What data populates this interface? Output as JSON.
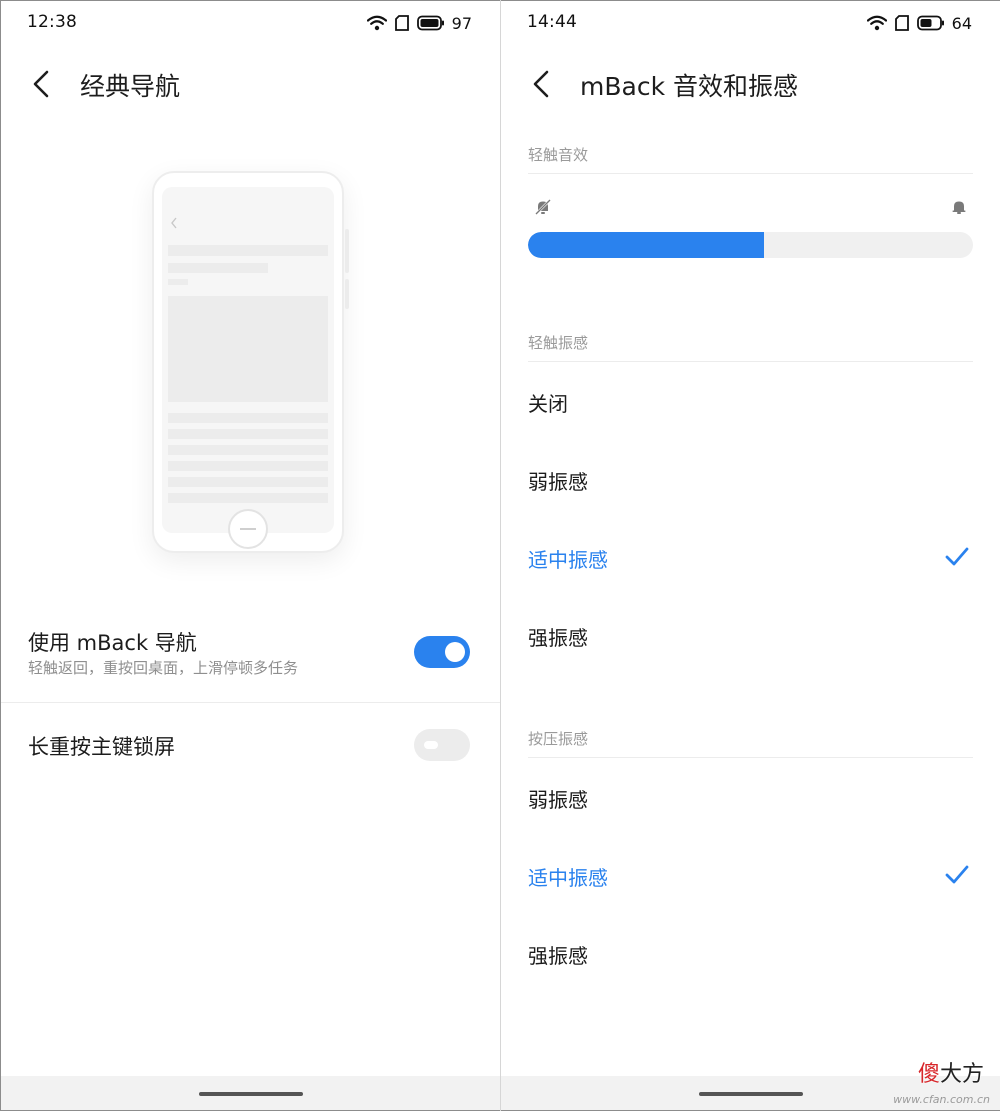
{
  "left_screen": {
    "status_bar": {
      "time": "12:38",
      "battery": "97"
    },
    "appbar": {
      "title": "经典导航"
    },
    "settings": [
      {
        "title": "使用 mBack 导航",
        "subtitle": "轻触返回，重按回桌面，上滑停顿多任务",
        "enabled": true
      },
      {
        "title": "长重按主键锁屏",
        "enabled": false
      }
    ]
  },
  "right_screen": {
    "status_bar": {
      "time": "14:44",
      "battery": "64"
    },
    "appbar": {
      "title": "mBack 音效和振感"
    },
    "sound": {
      "label": "轻触音效",
      "volume_level": 0.53
    },
    "touch_vibration": {
      "label": "轻触振感",
      "options": [
        "关闭",
        "弱振感",
        "适中振感",
        "强振感"
      ],
      "selected": "适中振感"
    },
    "press_vibration": {
      "label": "按压振感",
      "options": [
        "弱振感",
        "适中振感",
        "强振感"
      ],
      "selected": "适中振感"
    }
  },
  "watermark": {
    "part1": "傻",
    "part2": "大方",
    "url": "www.cfan.com.cn"
  },
  "colors": {
    "accent": "#2a82ee",
    "text": "#1c1c1c",
    "secondary": "#8f8f8f"
  }
}
